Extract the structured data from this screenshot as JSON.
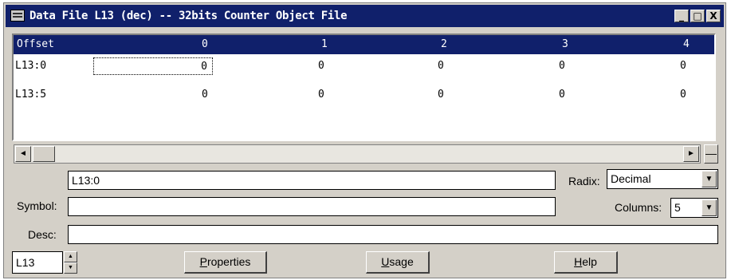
{
  "window": {
    "title": "Data File L13 (dec) -- 32bits Counter Object File",
    "controls": {
      "minimize": "_",
      "maximize": "□",
      "close": "X"
    }
  },
  "grid": {
    "header_label": "Offset",
    "columns": [
      "0",
      "1",
      "2",
      "3",
      "4"
    ],
    "rows": [
      {
        "label": "L13:0",
        "values": [
          "0",
          "0",
          "0",
          "0",
          "0"
        ]
      },
      {
        "label": "L13:5",
        "values": [
          "0",
          "0",
          "0",
          "0",
          "0"
        ]
      }
    ],
    "selected_row": 0,
    "selected_col": 0
  },
  "scrollbar": {
    "left_arrow": "◄",
    "right_arrow": "►",
    "split": "—"
  },
  "address": {
    "value": "L13:0"
  },
  "radix": {
    "label": "Radix:",
    "value": "Decimal"
  },
  "symbol": {
    "label": "Symbol:",
    "value": ""
  },
  "columns_select": {
    "label": "Columns:",
    "value": "5"
  },
  "desc": {
    "label": "Desc:",
    "value": ""
  },
  "file_selector": {
    "value": "L13",
    "up": "▲",
    "down": "▼"
  },
  "buttons": {
    "properties": {
      "accel": "P",
      "rest": "roperties"
    },
    "usage": {
      "accel": "U",
      "rest": "sage"
    },
    "help": {
      "accel": "H",
      "rest": "elp"
    }
  },
  "colors": {
    "title_bg": "#10206b",
    "header_bg": "#10206b",
    "face": "#d4d0c8"
  }
}
